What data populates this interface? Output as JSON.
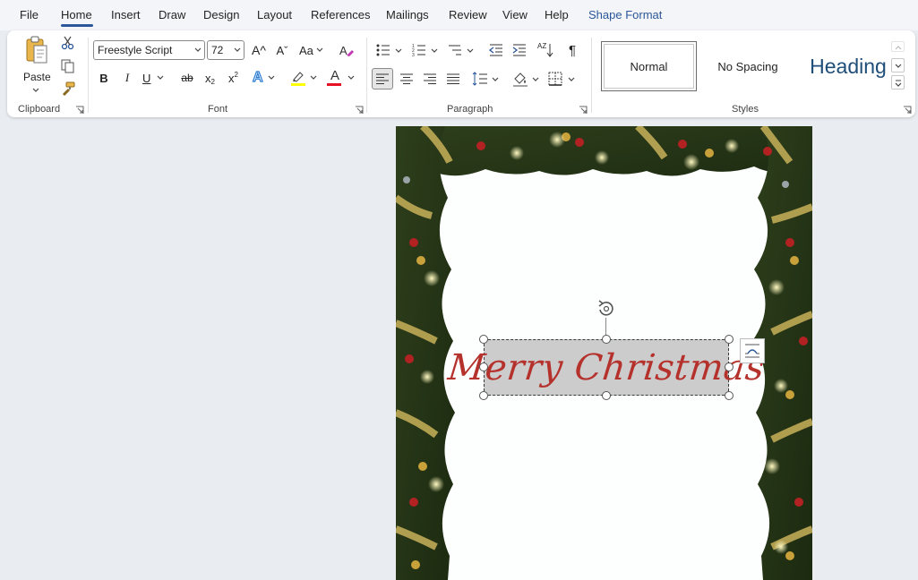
{
  "menu": {
    "tabs": [
      {
        "label": "File"
      },
      {
        "label": "Home"
      },
      {
        "label": "Insert"
      },
      {
        "label": "Draw"
      },
      {
        "label": "Design"
      },
      {
        "label": "Layout"
      },
      {
        "label": "References"
      },
      {
        "label": "Mailings"
      },
      {
        "label": "Review"
      },
      {
        "label": "View"
      },
      {
        "label": "Help"
      },
      {
        "label": "Shape Format"
      }
    ],
    "active_tab": "Home"
  },
  "ribbon": {
    "clipboard": {
      "label": "Clipboard",
      "paste_label": "Paste",
      "icons": [
        "paste-icon",
        "cut-icon",
        "copy-icon",
        "format-painter-icon"
      ]
    },
    "font": {
      "label": "Font",
      "font_name": "Freestyle Script",
      "font_size": "72",
      "grow_icon": "A^",
      "shrink_icon": "Aˇ",
      "change_case_label": "Aa",
      "bold": "B",
      "italic": "I",
      "underline": "U",
      "strikethrough": "ab",
      "subscript": "x",
      "subscript_mark": "2",
      "superscript": "x",
      "superscript_mark": "2",
      "text_effects": "A",
      "font_color_letter": "A",
      "highlight_color": "#ffff00",
      "font_color": "#e81123"
    },
    "paragraph": {
      "label": "Paragraph",
      "icons": [
        "bullets-icon",
        "numbering-icon",
        "multilevel-list-icon",
        "decrease-indent-icon",
        "increase-indent-icon",
        "sort-icon",
        "pilcrow-icon",
        "align-left-icon",
        "align-center-icon",
        "align-right-icon",
        "justify-icon",
        "line-spacing-icon",
        "shading-icon",
        "borders-icon"
      ],
      "sort_label": "AZ",
      "pilcrow": "¶"
    },
    "styles": {
      "label": "Styles",
      "items": [
        {
          "label": "Normal"
        },
        {
          "label": "No Spacing"
        },
        {
          "label": "Heading"
        }
      ]
    }
  },
  "document": {
    "textbox_text": "Merry Christmas",
    "text_color": "#b5312c",
    "textbox_fill": "#cccccc"
  },
  "colors": {
    "accent": "#2b579a",
    "ribbon_bg": "#ffffff",
    "app_bg": "#e9ecf0"
  }
}
